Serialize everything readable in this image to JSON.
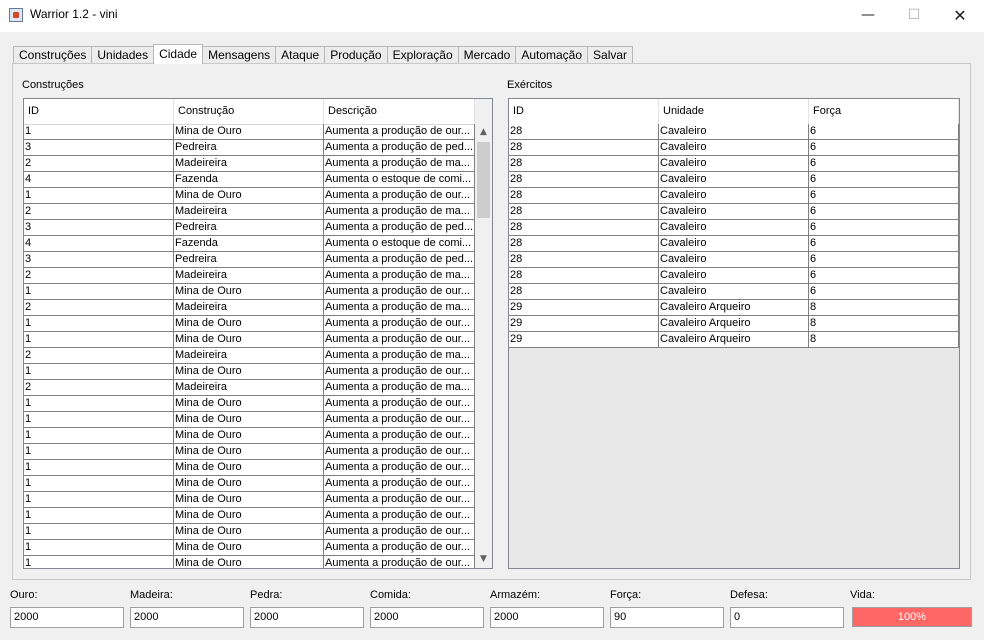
{
  "window": {
    "title": "Warrior 1.2 - vini",
    "minimize": "—",
    "maximize": "☐",
    "close": "✕"
  },
  "tabs": [
    "Construções",
    "Unidades",
    "Cidade",
    "Mensagens",
    "Ataque",
    "Produção",
    "Exploração",
    "Mercado",
    "Automação",
    "Salvar"
  ],
  "active_tab": "Cidade",
  "left_section": {
    "label": "Construções",
    "columns": [
      "ID",
      "Construção",
      "Descrição"
    ],
    "rows": [
      [
        "1",
        "Mina de Ouro",
        "Aumenta a produção de our..."
      ],
      [
        "3",
        "Pedreira",
        "Aumenta a produção de ped..."
      ],
      [
        "2",
        "Madeireira",
        "Aumenta a produção de ma..."
      ],
      [
        "4",
        "Fazenda",
        "Aumenta o estoque de comi..."
      ],
      [
        "1",
        "Mina de Ouro",
        "Aumenta a produção de our..."
      ],
      [
        "2",
        "Madeireira",
        "Aumenta a produção de ma..."
      ],
      [
        "3",
        "Pedreira",
        "Aumenta a produção de ped..."
      ],
      [
        "4",
        "Fazenda",
        "Aumenta o estoque de comi..."
      ],
      [
        "3",
        "Pedreira",
        "Aumenta a produção de ped..."
      ],
      [
        "2",
        "Madeireira",
        "Aumenta a produção de ma..."
      ],
      [
        "1",
        "Mina de Ouro",
        "Aumenta a produção de our..."
      ],
      [
        "2",
        "Madeireira",
        "Aumenta a produção de ma..."
      ],
      [
        "1",
        "Mina de Ouro",
        "Aumenta a produção de our..."
      ],
      [
        "1",
        "Mina de Ouro",
        "Aumenta a produção de our..."
      ],
      [
        "2",
        "Madeireira",
        "Aumenta a produção de ma..."
      ],
      [
        "1",
        "Mina de Ouro",
        "Aumenta a produção de our..."
      ],
      [
        "2",
        "Madeireira",
        "Aumenta a produção de ma..."
      ],
      [
        "1",
        "Mina de Ouro",
        "Aumenta a produção de our..."
      ],
      [
        "1",
        "Mina de Ouro",
        "Aumenta a produção de our..."
      ],
      [
        "1",
        "Mina de Ouro",
        "Aumenta a produção de our..."
      ],
      [
        "1",
        "Mina de Ouro",
        "Aumenta a produção de our..."
      ],
      [
        "1",
        "Mina de Ouro",
        "Aumenta a produção de our..."
      ],
      [
        "1",
        "Mina de Ouro",
        "Aumenta a produção de our..."
      ],
      [
        "1",
        "Mina de Ouro",
        "Aumenta a produção de our..."
      ],
      [
        "1",
        "Mina de Ouro",
        "Aumenta a produção de our..."
      ],
      [
        "1",
        "Mina de Ouro",
        "Aumenta a produção de our..."
      ],
      [
        "1",
        "Mina de Ouro",
        "Aumenta a produção de our..."
      ],
      [
        "1",
        "Mina de Ouro",
        "Aumenta a produção de our..."
      ]
    ],
    "scroll_up_icon": "chevron-up",
    "scroll_down_icon": "chevron-down"
  },
  "right_section": {
    "label": "Exércitos",
    "columns": [
      "ID",
      "Unidade",
      "Força"
    ],
    "rows": [
      [
        "28",
        "Cavaleiro",
        "6"
      ],
      [
        "28",
        "Cavaleiro",
        "6"
      ],
      [
        "28",
        "Cavaleiro",
        "6"
      ],
      [
        "28",
        "Cavaleiro",
        "6"
      ],
      [
        "28",
        "Cavaleiro",
        "6"
      ],
      [
        "28",
        "Cavaleiro",
        "6"
      ],
      [
        "28",
        "Cavaleiro",
        "6"
      ],
      [
        "28",
        "Cavaleiro",
        "6"
      ],
      [
        "28",
        "Cavaleiro",
        "6"
      ],
      [
        "28",
        "Cavaleiro",
        "6"
      ],
      [
        "28",
        "Cavaleiro",
        "6"
      ],
      [
        "29",
        "Cavaleiro Arqueiro",
        "8"
      ],
      [
        "29",
        "Cavaleiro Arqueiro",
        "8"
      ],
      [
        "29",
        "Cavaleiro Arqueiro",
        "8"
      ]
    ]
  },
  "status": {
    "ouro": {
      "label": "Ouro:",
      "value": "2000"
    },
    "madeira": {
      "label": "Madeira:",
      "value": "2000"
    },
    "pedra": {
      "label": "Pedra:",
      "value": "2000"
    },
    "comida": {
      "label": "Comida:",
      "value": "2000"
    },
    "armazem": {
      "label": "Armazém:",
      "value": "2000"
    },
    "forca": {
      "label": "Força:",
      "value": "90"
    },
    "defesa": {
      "label": "Defesa:",
      "value": "0"
    },
    "vida": {
      "label": "Vida:",
      "text": "100%",
      "fraction": 1.0,
      "color": "#ff6666"
    }
  }
}
